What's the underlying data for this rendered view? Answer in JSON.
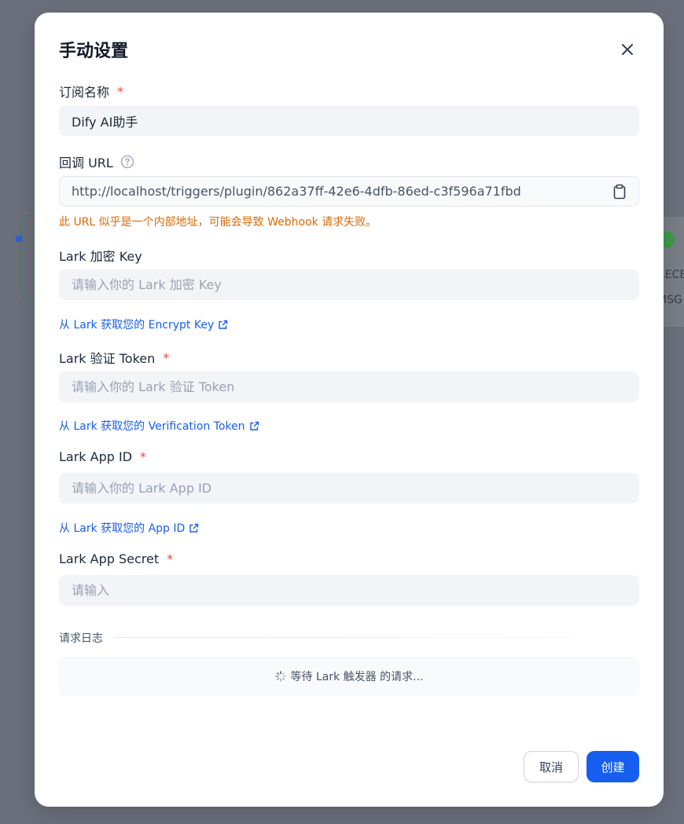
{
  "background": {
    "card_text_1": "RECE",
    "card_text_2": "MSG"
  },
  "modal": {
    "title": "手动设置",
    "close_icon": "close-icon",
    "subscription_name": {
      "label": "订阅名称",
      "required_mark": "*",
      "value": "Dify AI助手"
    },
    "callback_url": {
      "label": "回调 URL",
      "help_icon": "question-circle-icon",
      "value": "http://localhost/triggers/plugin/862a37ff-42e6-4dfb-86ed-c3f596a71fbd",
      "copy_icon": "clipboard-icon",
      "warning": "此 URL 似乎是一个内部地址，可能会导致 Webhook 请求失败。"
    },
    "encrypt_key": {
      "label": "Lark 加密 Key",
      "placeholder": "请输入你的 Lark 加密 Key",
      "help_link": "从 Lark 获取您的 Encrypt Key"
    },
    "verification_token": {
      "label": "Lark 验证 Token",
      "required_mark": "*",
      "placeholder": "请输入你的 Lark 验证 Token",
      "help_link": "从 Lark 获取您的 Verification Token"
    },
    "app_id": {
      "label": "Lark App ID",
      "required_mark": "*",
      "placeholder": "请输入你的 Lark App ID",
      "help_link": "从 Lark 获取您的 App ID"
    },
    "app_secret": {
      "label": "Lark App Secret",
      "required_mark": "*",
      "placeholder": "请输入"
    },
    "request_log": {
      "label": "请求日志",
      "status": "等待 Lark 触发器 的请求..."
    },
    "buttons": {
      "cancel": "取消",
      "create": "创建"
    },
    "colors": {
      "accent": "#155eef",
      "required": "#f04438",
      "warning": "#dc6803"
    }
  }
}
